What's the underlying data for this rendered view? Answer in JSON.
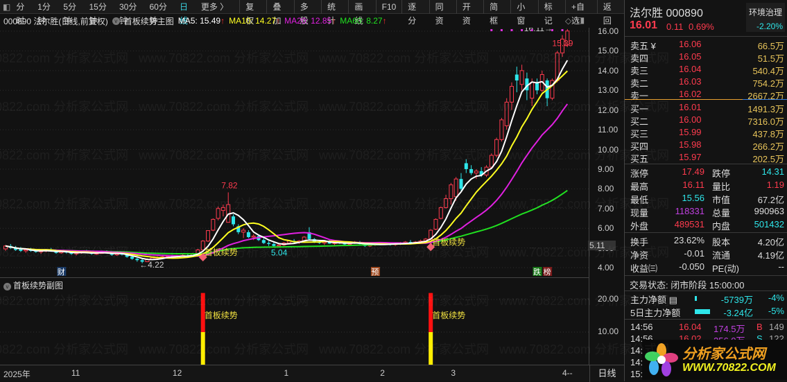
{
  "toolbar": {
    "periods": [
      "分时",
      "1分钟",
      "5分钟",
      "15分钟",
      "30分钟",
      "60分钟",
      "日线",
      "更多 〉"
    ],
    "active": "日线",
    "buttons": [
      "复权",
      "叠加",
      "多股",
      "统计",
      "画线",
      "F10",
      "逐分",
      "同资",
      "开资",
      "简框",
      "小窗",
      "标记",
      "+自选",
      "返回"
    ]
  },
  "info": {
    "title": "000890 法尔胜(日线,前复权)",
    "indicator": "首板续势主图",
    "ma5": "MA5: 15.49",
    "ma10": "MA10: 14.27",
    "ma20": "MA20: 12.85",
    "ma60": "MA60: 8.27",
    "arrow": "↑"
  },
  "colors": {
    "up": "#ff3b4e",
    "down": "#2ee6ea",
    "ma5": "#ffffff",
    "ma10": "#ffff20",
    "ma20": "#e020e0",
    "ma60": "#20e020"
  },
  "chart_data": {
    "type": "candlestick",
    "price_axis": [
      "16.00",
      "15.00",
      "14.00",
      "13.00",
      "12.00",
      "11.00",
      "10.00",
      "9.00",
      "8.00",
      "7.00",
      "6.00",
      "5.00",
      "4.00"
    ],
    "ylim": [
      4,
      16
    ],
    "current_tag": "5.11",
    "annotations": {
      "high": "7.82",
      "low": "4.22",
      "low2": "5.04",
      "last_high": "16.11",
      "last": "15.39",
      "signal": "首板续势"
    },
    "markers": [
      {
        "idx": 11,
        "text": "财",
        "bg": "#1a3a66"
      },
      {
        "idx": 73,
        "text": "预",
        "bg": "#a04a20"
      },
      {
        "idx": 105,
        "text": "跌",
        "bg": "#1a7a1a"
      },
      {
        "idx": 107,
        "text": "榜",
        "bg": "#7a1a1a"
      }
    ],
    "signal_idx": [
      39,
      84
    ],
    "candles": [
      [
        4.95,
        5.15,
        4.85,
        5.1
      ],
      [
        5.1,
        5.2,
        4.95,
        5.0
      ],
      [
        5.0,
        5.1,
        4.85,
        4.9
      ],
      [
        4.95,
        5.05,
        4.8,
        4.85
      ],
      [
        4.85,
        4.95,
        4.75,
        4.9
      ],
      [
        4.9,
        5.0,
        4.8,
        4.85
      ],
      [
        4.85,
        4.9,
        4.75,
        4.8
      ],
      [
        4.8,
        4.9,
        4.7,
        4.85
      ],
      [
        4.85,
        4.95,
        4.78,
        4.9
      ],
      [
        4.9,
        5.0,
        4.8,
        4.82
      ],
      [
        4.82,
        4.9,
        4.7,
        4.75
      ],
      [
        4.75,
        4.85,
        4.7,
        4.8
      ],
      [
        4.8,
        4.9,
        4.72,
        4.78
      ],
      [
        4.78,
        4.85,
        4.65,
        4.7
      ],
      [
        4.7,
        4.8,
        4.62,
        4.75
      ],
      [
        4.75,
        4.85,
        4.7,
        4.8
      ],
      [
        4.8,
        4.9,
        4.72,
        4.76
      ],
      [
        4.76,
        4.82,
        4.65,
        4.7
      ],
      [
        4.7,
        4.8,
        4.65,
        4.72
      ],
      [
        4.72,
        4.85,
        4.7,
        4.8
      ],
      [
        4.8,
        4.88,
        4.72,
        4.75
      ],
      [
        4.75,
        4.8,
        4.6,
        4.65
      ],
      [
        4.65,
        4.75,
        4.6,
        4.7
      ],
      [
        4.7,
        4.8,
        4.62,
        4.66
      ],
      [
        4.66,
        4.72,
        4.5,
        4.55
      ],
      [
        4.55,
        4.6,
        4.4,
        4.45
      ],
      [
        4.45,
        4.5,
        4.3,
        4.38
      ],
      [
        4.38,
        4.45,
        4.22,
        4.3
      ],
      [
        4.3,
        4.48,
        4.28,
        4.42
      ],
      [
        4.42,
        4.55,
        4.4,
        4.5
      ],
      [
        4.5,
        4.58,
        4.45,
        4.52
      ],
      [
        4.52,
        4.6,
        4.48,
        4.55
      ],
      [
        4.55,
        4.62,
        4.5,
        4.58
      ],
      [
        4.58,
        4.65,
        4.5,
        4.55
      ],
      [
        4.55,
        4.62,
        4.5,
        4.6
      ],
      [
        4.6,
        4.68,
        4.55,
        4.62
      ],
      [
        4.62,
        4.7,
        4.55,
        4.6
      ],
      [
        4.6,
        4.75,
        4.58,
        4.7
      ],
      [
        4.7,
        4.95,
        4.68,
        4.9
      ],
      [
        4.9,
        5.4,
        4.88,
        5.35
      ],
      [
        5.35,
        5.9,
        5.3,
        5.88
      ],
      [
        5.9,
        6.5,
        5.85,
        6.45
      ],
      [
        6.5,
        7.1,
        6.4,
        7.0
      ],
      [
        6.9,
        7.2,
        6.6,
        7.05
      ],
      [
        6.3,
        7.82,
        6.3,
        7.2
      ],
      [
        6.6,
        6.7,
        6.1,
        6.2
      ],
      [
        6.1,
        6.2,
        5.7,
        5.8
      ],
      [
        5.8,
        6.0,
        5.5,
        5.9
      ],
      [
        5.8,
        5.9,
        5.5,
        5.55
      ],
      [
        5.55,
        5.7,
        5.4,
        5.6
      ],
      [
        5.6,
        5.65,
        5.35,
        5.4
      ],
      [
        5.4,
        5.5,
        5.2,
        5.25
      ],
      [
        5.25,
        5.35,
        5.1,
        5.2
      ],
      [
        5.2,
        5.3,
        5.04,
        5.1
      ],
      [
        5.1,
        5.2,
        5.05,
        5.15
      ],
      [
        5.15,
        5.3,
        5.1,
        5.25
      ],
      [
        5.25,
        5.4,
        5.2,
        5.35
      ],
      [
        5.35,
        5.45,
        5.25,
        5.3
      ],
      [
        5.3,
        5.4,
        5.2,
        5.35
      ],
      [
        5.35,
        5.6,
        5.3,
        5.55
      ],
      [
        5.8,
        6.05,
        5.4,
        5.45
      ],
      [
        5.45,
        5.5,
        5.25,
        5.3
      ],
      [
        5.3,
        5.4,
        5.2,
        5.25
      ],
      [
        5.25,
        5.35,
        5.15,
        5.3
      ],
      [
        5.3,
        5.4,
        5.2,
        5.22
      ],
      [
        5.22,
        5.3,
        5.15,
        5.28
      ],
      [
        5.28,
        5.35,
        5.2,
        5.25
      ],
      [
        5.25,
        5.3,
        5.15,
        5.18
      ],
      [
        5.18,
        5.3,
        5.15,
        5.25
      ],
      [
        5.25,
        5.35,
        5.2,
        5.3
      ],
      [
        5.3,
        5.35,
        5.15,
        5.2
      ],
      [
        5.2,
        5.25,
        5.05,
        5.1
      ],
      [
        5.1,
        5.2,
        5.05,
        5.15
      ],
      [
        5.15,
        5.25,
        5.1,
        5.2
      ],
      [
        5.2,
        5.3,
        5.15,
        5.22
      ],
      [
        5.22,
        5.28,
        5.15,
        5.2
      ],
      [
        5.2,
        5.25,
        5.12,
        5.18
      ],
      [
        5.18,
        5.25,
        5.1,
        5.2
      ],
      [
        5.2,
        5.3,
        5.15,
        5.25
      ],
      [
        5.25,
        5.35,
        5.2,
        5.3
      ],
      [
        5.3,
        5.4,
        5.22,
        5.28
      ],
      [
        5.28,
        5.35,
        5.2,
        5.3
      ],
      [
        5.3,
        5.42,
        5.25,
        5.35
      ],
      [
        5.35,
        5.5,
        5.3,
        5.45
      ],
      [
        5.45,
        5.95,
        5.4,
        5.9
      ],
      [
        5.95,
        6.5,
        5.9,
        6.45
      ],
      [
        6.5,
        7.1,
        6.45,
        7.05
      ],
      [
        7.05,
        7.7,
        7.0,
        7.5
      ],
      [
        7.5,
        8.3,
        7.2,
        8.2
      ],
      [
        7.6,
        8.6,
        7.4,
        8.5
      ],
      [
        8.5,
        8.8,
        7.9,
        8.0
      ],
      [
        9.3,
        9.5,
        8.8,
        9.0
      ],
      [
        9.0,
        9.2,
        8.7,
        8.8
      ],
      [
        8.8,
        9.0,
        8.5,
        8.9
      ],
      [
        8.9,
        9.1,
        8.6,
        8.7
      ],
      [
        8.7,
        9.2,
        8.6,
        9.1
      ],
      [
        9.1,
        9.8,
        9.0,
        9.7
      ],
      [
        9.7,
        10.6,
        9.6,
        10.5
      ],
      [
        10.5,
        11.6,
        10.4,
        11.5
      ],
      [
        11.2,
        12.6,
        11.0,
        12.4
      ],
      [
        12.4,
        13.4,
        12.0,
        13.2
      ],
      [
        13.8,
        14.2,
        12.9,
        13.5
      ],
      [
        13.3,
        14.3,
        13.0,
        14.0
      ],
      [
        13.6,
        13.9,
        12.5,
        13.0
      ],
      [
        12.6,
        13.6,
        12.2,
        13.4
      ],
      [
        13.4,
        13.6,
        12.8,
        13.0
      ],
      [
        13.0,
        14.0,
        12.9,
        13.8
      ],
      [
        13.5,
        13.6,
        12.2,
        12.6
      ],
      [
        12.6,
        13.6,
        12.5,
        13.5
      ],
      [
        13.5,
        15.0,
        13.4,
        14.9
      ],
      [
        14.9,
        15.8,
        14.7,
        15.6
      ],
      [
        15.3,
        16.11,
        15.2,
        16.01
      ]
    ]
  },
  "sub": {
    "title": "首板续势副图",
    "axis": [
      "20.00",
      "10.00"
    ],
    "bar_label": "首板续势",
    "bar_total": 22,
    "bar_yellow": 10
  },
  "dates": {
    "labels": [
      {
        "t": "2025年",
        "i": 0
      },
      {
        "t": "11",
        "i": 13
      },
      {
        "t": "12",
        "i": 33
      },
      {
        "t": "1",
        "i": 55
      },
      {
        "t": "2",
        "i": 74
      },
      {
        "t": "3",
        "i": 88
      },
      {
        "t": "4--",
        "i": 110
      }
    ],
    "period": "日线"
  },
  "panel": {
    "name": "法尔胜 000890",
    "price": "16.01",
    "change": "0.11",
    "pct": "0.69%",
    "sector": "环境治理",
    "sector_pct": "-2.20%",
    "asks": [
      [
        "卖五 ¥",
        "16.06",
        "66.5万"
      ],
      [
        "卖四",
        "16.05",
        "51.5万"
      ],
      [
        "卖三",
        "16.04",
        "540.4万"
      ],
      [
        "卖二",
        "16.03",
        "754.2万"
      ],
      [
        "卖一",
        "16.02",
        "2667.2万"
      ]
    ],
    "bids": [
      [
        "买一",
        "16.01",
        "1491.3万"
      ],
      [
        "买二",
        "16.00",
        "7316.0万"
      ],
      [
        "买三",
        "15.99",
        "437.8万"
      ],
      [
        "买四",
        "15.98",
        "266.2万"
      ],
      [
        "买五",
        "15.97",
        "202.5万"
      ]
    ],
    "stats": [
      [
        "涨停",
        "17.49",
        "red",
        "跌停",
        "14.31",
        "cyan"
      ],
      [
        "最高",
        "16.11",
        "red",
        "量比",
        "1.19",
        "red"
      ],
      [
        "最低",
        "15.56",
        "cyan",
        "市值",
        "67.2亿",
        "wht"
      ],
      [
        "现量",
        "118331",
        "mag",
        "总量",
        "990963",
        "wht"
      ],
      [
        "外盘",
        "489531",
        "red",
        "内盘",
        "501432",
        "cyan"
      ]
    ],
    "stats2": [
      [
        "换手",
        "23.62%",
        "股本",
        "4.20亿"
      ],
      [
        "净资",
        "-0.01",
        "流通",
        "4.19亿"
      ],
      [
        "收益㈢",
        "-0.050",
        "PE(动)",
        "--"
      ]
    ],
    "status": "交易状态: 闭市阶段 15:00:00",
    "flows": [
      [
        "主力净额",
        "-5739万",
        "-4%"
      ],
      [
        "5日主力净额",
        "-3.24亿",
        "-5%"
      ]
    ],
    "ticks": [
      [
        "14:56",
        "16.04",
        "174.5万",
        "B",
        "149"
      ],
      [
        "14:56",
        "16.02",
        "256.0万",
        "S",
        "122"
      ],
      [
        "14:5",
        "",
        "",
        "",
        ""
      ],
      [
        "14:5",
        "",
        "",
        "",
        ""
      ],
      [
        "15:00",
        "",
        "",
        "",
        ""
      ]
    ],
    "logo": {
      "cn": "分析家公式网",
      "url": "WWW.70822.COM"
    }
  },
  "watermark": "www.70822.com 分析家公式网"
}
